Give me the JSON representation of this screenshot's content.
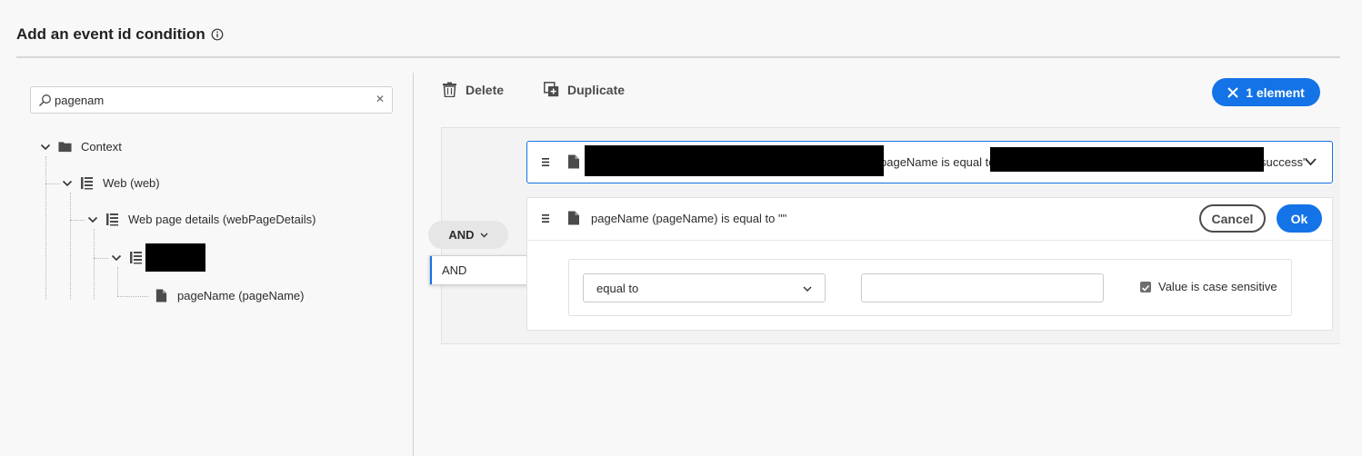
{
  "dialog": {
    "title": "Add an event id condition"
  },
  "search": {
    "value": "pagenam",
    "placeholder": "",
    "clear_glyph": "✕"
  },
  "tree": {
    "items": [
      {
        "label": "Context",
        "icon": "folder-icon"
      },
      {
        "label": "Web (web)",
        "icon": "schema-field-icon"
      },
      {
        "label": "Web page details (webPageDetails)",
        "icon": "schema-field-icon"
      },
      {
        "label": "",
        "icon": "schema-field-icon",
        "redacted": true
      },
      {
        "label": "pageName (pageName)",
        "icon": "document-icon"
      }
    ]
  },
  "toolbar": {
    "delete_label": "Delete",
    "duplicate_label": "Duplicate",
    "selection_label": "1 element"
  },
  "group": {
    "operator_label": "AND",
    "operator_menu": {
      "options": [
        "AND"
      ],
      "selected": "AND"
    }
  },
  "conditions": [
    {
      "text_a": "pageName is equal to",
      "text_b": "success\"",
      "expanded": false
    },
    {
      "text": "pageName (pageName) is equal to \"\"",
      "expanded": true,
      "cancel_label": "Cancel",
      "ok_label": "Ok",
      "operator_value": "equal to",
      "value": "",
      "case_sensitive_label": "Value is case sensitive",
      "case_sensitive": true
    }
  ],
  "colors": {
    "accent": "#1473e6",
    "background": "#f8f8f8"
  }
}
